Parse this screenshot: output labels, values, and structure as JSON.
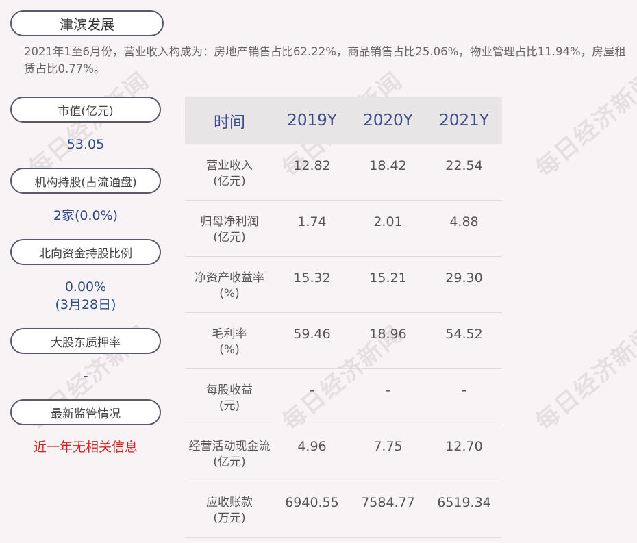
{
  "company_name": "津滨发展",
  "summary": "2021年1至6月份，营业收入构成为：房地产销售占比62.22%，商品销售占比25.06%，物业管理占比11.94%，房屋租赁占比0.77%。",
  "watermark_text": "每日经济新闻",
  "left_panel": {
    "market_cap_label": "市值(亿元)",
    "market_cap_value": "53.05",
    "institution_label": "机构持股(占流通盘)",
    "institution_value": "2家(0.0%)",
    "northbound_label": "北向资金持股比例",
    "northbound_value": "0.00%",
    "northbound_date": "(3月28日)",
    "pledge_label": "大股东质押率",
    "pledge_value": "-",
    "regulation_label": "最新监管情况",
    "regulation_value": "近一年无相关信息"
  },
  "table": {
    "headers": [
      "时间",
      "2019Y",
      "2020Y",
      "2021Y"
    ],
    "rows": [
      {
        "label": "营业收入",
        "unit": "(亿元)",
        "values": [
          "12.82",
          "18.42",
          "22.54"
        ]
      },
      {
        "label": "归母净利润",
        "unit": "(亿元)",
        "values": [
          "1.74",
          "2.01",
          "4.88"
        ]
      },
      {
        "label": "净资产收益率",
        "unit": "(%)",
        "values": [
          "15.32",
          "15.21",
          "29.30"
        ]
      },
      {
        "label": "毛利率",
        "unit": "(%)",
        "values": [
          "59.46",
          "18.96",
          "54.52"
        ]
      },
      {
        "label": "每股收益",
        "unit": "(元)",
        "values": [
          "-",
          "-",
          "-"
        ]
      },
      {
        "label": "经营活动现金流",
        "unit": "(亿元)",
        "values": [
          "4.96",
          "7.75",
          "12.70"
        ]
      },
      {
        "label": "应收账款",
        "unit": "(万元)",
        "values": [
          "6940.55",
          "7584.77",
          "6519.34"
        ]
      }
    ]
  },
  "colors": {
    "accent": "#2b4a8c",
    "alert": "#d92121",
    "header_bg": "#e8e5e6"
  }
}
